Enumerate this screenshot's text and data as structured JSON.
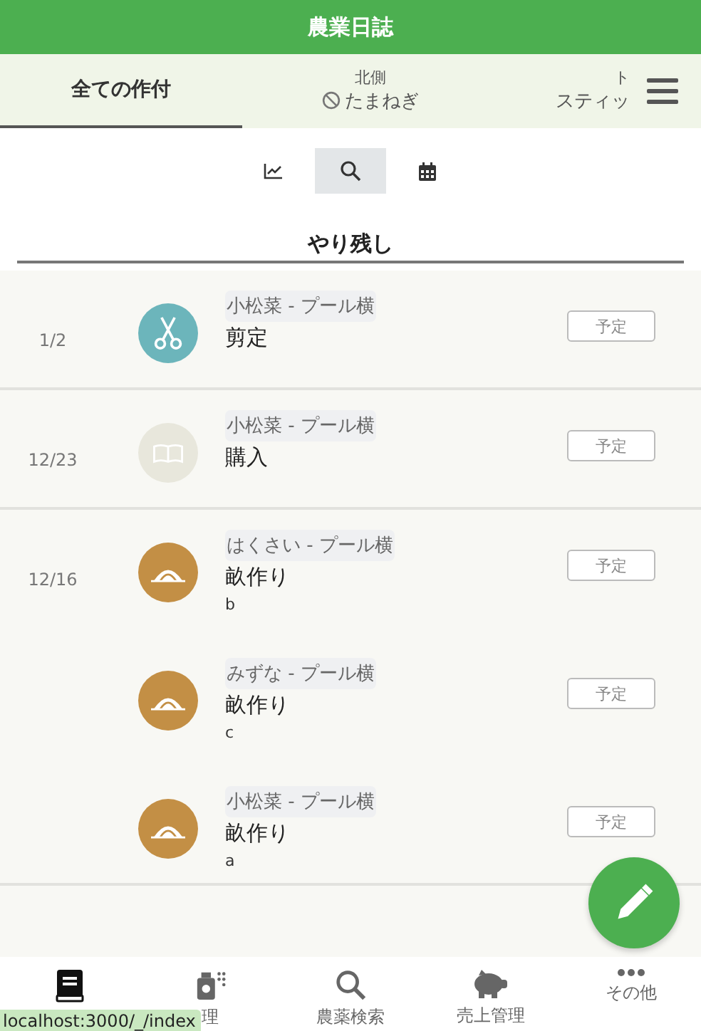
{
  "header": {
    "title": "農業日誌"
  },
  "tabs": [
    {
      "kind": "all",
      "label": "全ての作付",
      "selected": true
    },
    {
      "kind": "field",
      "field": "北側",
      "crop": "たまねぎ",
      "ended": true,
      "selected": false
    },
    {
      "kind": "field",
      "field": "ト",
      "crop": "スティッ",
      "ended": false,
      "selected": false
    }
  ],
  "views": [
    {
      "kind": "chart",
      "selected": false
    },
    {
      "kind": "search",
      "selected": true
    },
    {
      "kind": "calendar",
      "selected": false
    }
  ],
  "section": {
    "title": "やり残し"
  },
  "groups": [
    {
      "date": "1/2",
      "entries": [
        {
          "kind": "scissors",
          "color": "#6cb5bb",
          "location": "小松菜 - プール横",
          "task": "剪定",
          "status": "予定"
        }
      ]
    },
    {
      "date": "12/23",
      "entries": [
        {
          "kind": "book",
          "color": "#e8e7dc",
          "location": "小松菜 - プール横",
          "task": "購入",
          "status": "予定"
        }
      ]
    },
    {
      "date": "12/16",
      "entries": [
        {
          "kind": "mound",
          "color": "#c38f45",
          "location": "はくさい - プール横",
          "task": "畝作り",
          "note": "b",
          "status": "予定"
        },
        {
          "kind": "mound",
          "color": "#c38f45",
          "location": "みずな - プール横",
          "task": "畝作り",
          "note": "c",
          "status": "予定"
        },
        {
          "kind": "mound",
          "color": "#c38f45",
          "location": "小松菜 - プール横",
          "task": "畝作り",
          "note": "a",
          "status": "予定"
        }
      ]
    }
  ],
  "nav": [
    {
      "kind": "book",
      "selected": true
    },
    {
      "kind": "sprayer",
      "label": "理",
      "selected": false
    },
    {
      "kind": "search",
      "label": "農薬検索",
      "selected": false
    },
    {
      "kind": "pig",
      "label": "売上管理",
      "selected": false
    },
    {
      "kind": "dots",
      "label": "その他",
      "selected": false
    }
  ],
  "status_link": "localhost:3000/_/index"
}
